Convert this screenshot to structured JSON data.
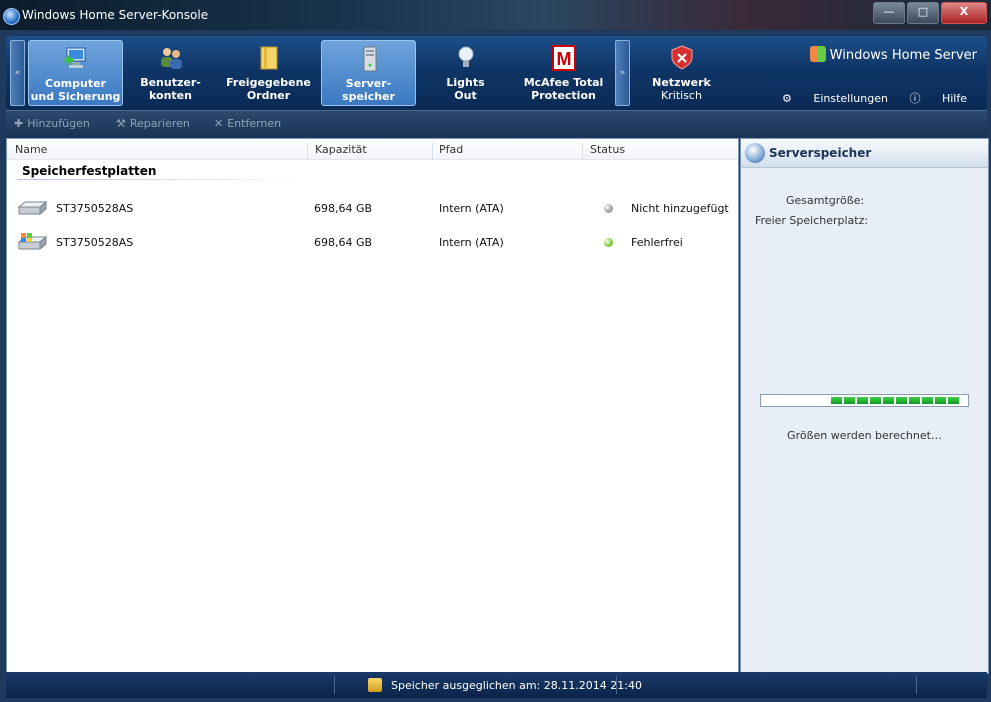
{
  "window": {
    "title": "Windows Home Server-Konsole",
    "min": "—",
    "max": "□",
    "close": "X"
  },
  "nav": {
    "left_arrow": "«",
    "right_arrow": "»",
    "tabs": [
      {
        "l1": "Computer",
        "l2": "und Sicherung"
      },
      {
        "l1": "Benutzer-",
        "l2": "konten"
      },
      {
        "l1": "Freigegebene",
        "l2": "Ordner"
      },
      {
        "l1": "Server-",
        "l2": "speicher"
      },
      {
        "l1": "Lights",
        "l2": "Out"
      },
      {
        "l1": "McAfee Total",
        "l2": "Protection"
      }
    ],
    "network": {
      "label": "Netzwerk",
      "status": "Kritisch"
    },
    "brand": "Windows Home Server",
    "settings": "Einstellungen",
    "help": "Hilfe"
  },
  "toolbar": {
    "add": "Hinzufügen",
    "repair": "Reparieren",
    "remove": "Entfernen"
  },
  "table": {
    "columns": [
      "Name",
      "Kapazität",
      "Pfad",
      "Status"
    ],
    "group": "Speicherfestplatten",
    "rows": [
      {
        "name": "ST3750528AS",
        "capacity": "698,64 GB",
        "path": "Intern (ATA)",
        "status": "Nicht hinzugefügt",
        "status_color": "#9a9a9a"
      },
      {
        "name": "ST3750528AS",
        "capacity": "698,64 GB",
        "path": "Intern (ATA)",
        "status": "Fehlerfrei",
        "status_color": "#7ac42a"
      }
    ]
  },
  "panel": {
    "title": "Serverspeicher",
    "total_label": "Gesamtgröße:",
    "free_label": "Freier Speicherplatz:",
    "calc": "Größen werden berechnet…"
  },
  "statusbar": {
    "text": "Speicher ausgeglichen am: 28.11.2014 21:40"
  }
}
